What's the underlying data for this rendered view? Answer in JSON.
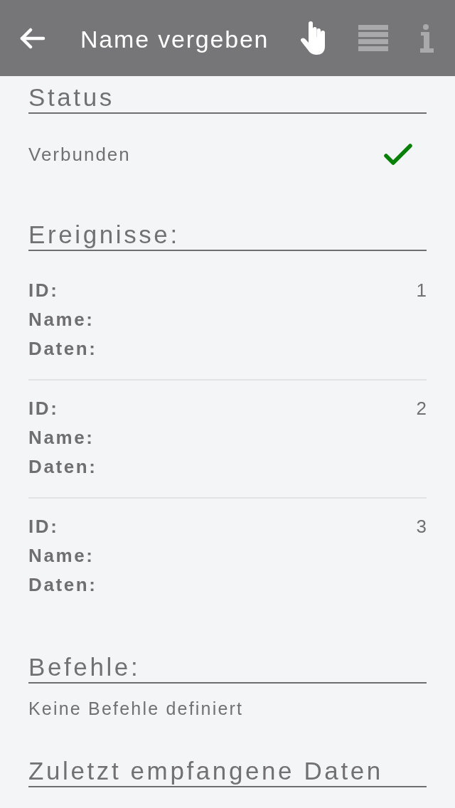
{
  "header": {
    "title": "Name vergeben",
    "actions": [
      {
        "kind": "touch",
        "disabled": false
      },
      {
        "kind": "list",
        "disabled": true
      },
      {
        "kind": "info",
        "disabled": true
      }
    ]
  },
  "sections": [
    {
      "kind": "status",
      "heading": "Status",
      "label": "Verbunden",
      "connected": true
    },
    {
      "kind": "events",
      "heading": "Ereignisse:",
      "events": [
        {
          "fields": [
            {
              "label": "ID:",
              "value": "1"
            },
            {
              "label": "Name:"
            },
            {
              "label": "Daten:"
            }
          ]
        },
        {
          "fields": [
            {
              "label": "ID:",
              "value": "2"
            },
            {
              "label": "Name:"
            },
            {
              "label": "Daten:"
            }
          ]
        },
        {
          "fields": [
            {
              "label": "ID:",
              "value": "3"
            },
            {
              "label": "Name:"
            },
            {
              "label": "Daten:"
            }
          ]
        }
      ]
    },
    {
      "kind": "text",
      "heading": "Befehle:",
      "text": "Keine Befehle definiert"
    },
    {
      "kind": "text",
      "heading": "Zuletzt empfangene Daten"
    }
  ]
}
